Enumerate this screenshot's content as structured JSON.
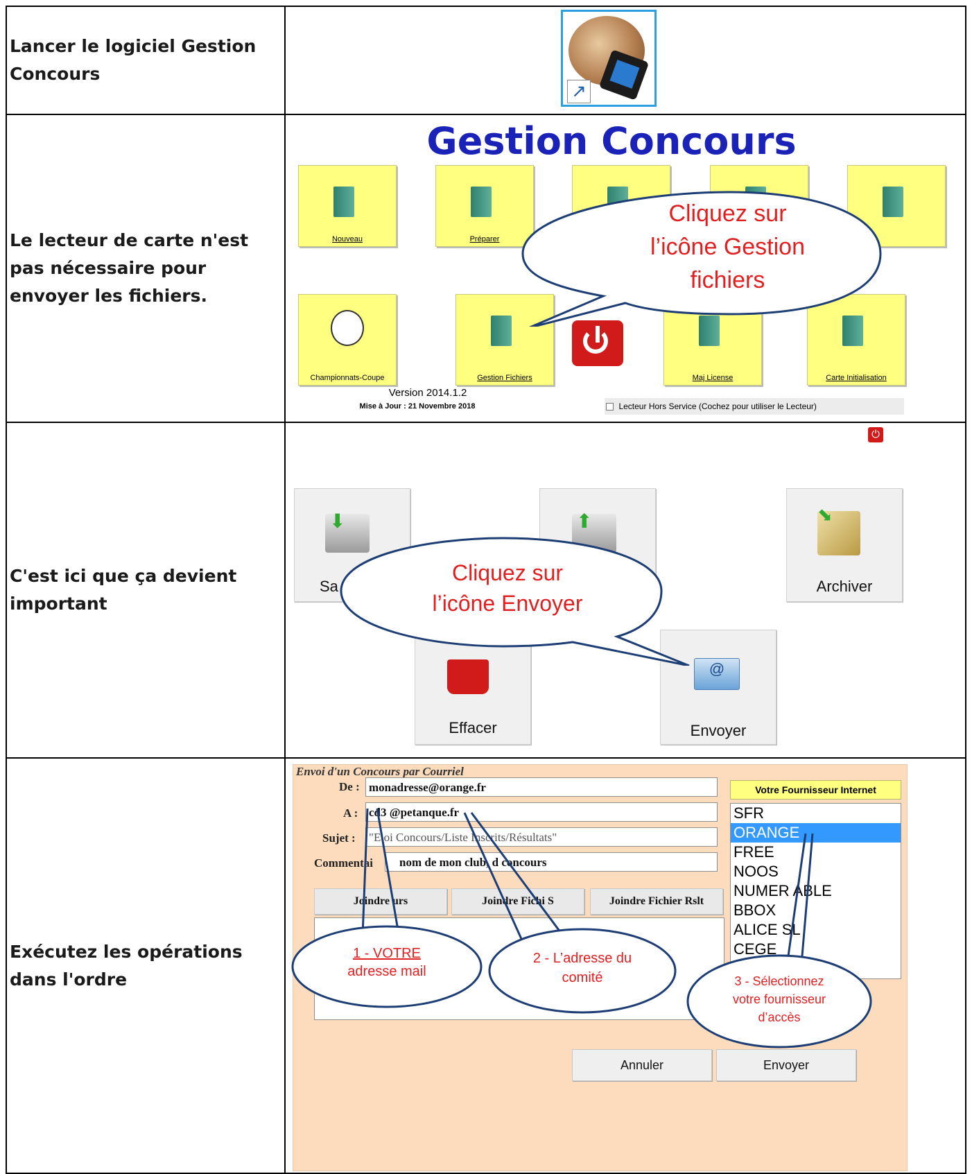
{
  "rows": [
    {
      "instruction": "Lancer le logiciel Gestion Concours"
    },
    {
      "instruction": "Le lecteur de carte n'est pas nécessaire pour envoyer les fichiers."
    },
    {
      "instruction": " C'est ici que ça devient important"
    },
    {
      "instruction": "Exécutez les opérations dans l'ordre"
    }
  ],
  "app_icon": {
    "name": "gestion-concours-icon"
  },
  "menu": {
    "title": "Gestion Concours",
    "buttons_top": [
      "Nouveau",
      "Préparer",
      "",
      "",
      ""
    ],
    "buttons_bottom": [
      "Championnats-Coupe",
      "Gestion Fichiers",
      "",
      "Maj License",
      "Carte Initialisation"
    ],
    "version": "Version 2014.1.2",
    "update": "Mise à Jour : 21 Novembre 2018",
    "checkbox_label": "Lecteur Hors Service (Cochez pour utiliser le Lecteur)",
    "bubble": [
      "Cliquez sur",
      "l’icône Gestion",
      "fichiers"
    ]
  },
  "files": {
    "buttons": {
      "save": "Sa",
      "restore": "",
      "archive": "Archiver",
      "delete": "Effacer",
      "send": "Envoyer"
    },
    "bubble": [
      "Cliquez sur",
      "l’icône Envoyer"
    ]
  },
  "email": {
    "title": "Envoi d'un Concours par Courriel",
    "from_label": "De :",
    "from_value": "monadresse@orange.fr",
    "to_label": "A  :",
    "to_value": "cd3   @petanque.fr",
    "subject_label": "Sujet :",
    "subject_value": "\"E    oi Concours/Liste Inscrits/Résultats\"",
    "comment_label": "Commentai",
    "comment_value": "nom de mon club, d    concours",
    "attach_buttons": [
      "Joindre        urs",
      "Joindre Fichi      S",
      "Joindre Fichier Rslt"
    ],
    "provider_header": "Votre Fournisseur Internet",
    "providers": [
      "SFR",
      "ORANGE",
      "FREE",
      "NOOS",
      "NUMER      ABLE",
      "BBOX",
      "ALICE      SL",
      "CEGE"
    ],
    "selected_provider": "ORANGE",
    "cancel": "Annuler",
    "send": "Envoyer",
    "callouts": [
      [
        "1 - VOTRE",
        "adresse mail"
      ],
      [
        "2 - L’adresse du",
        "comité"
      ],
      [
        "3 - Sélectionnez",
        "votre fournisseur",
        "d’accès"
      ]
    ]
  },
  "colors": {
    "menu_title": "#1a22b8",
    "yellow_button": "#ffff80",
    "form_bg": "#fcdcbc",
    "callout_text": "#e02020",
    "selected": "#3399ff"
  }
}
